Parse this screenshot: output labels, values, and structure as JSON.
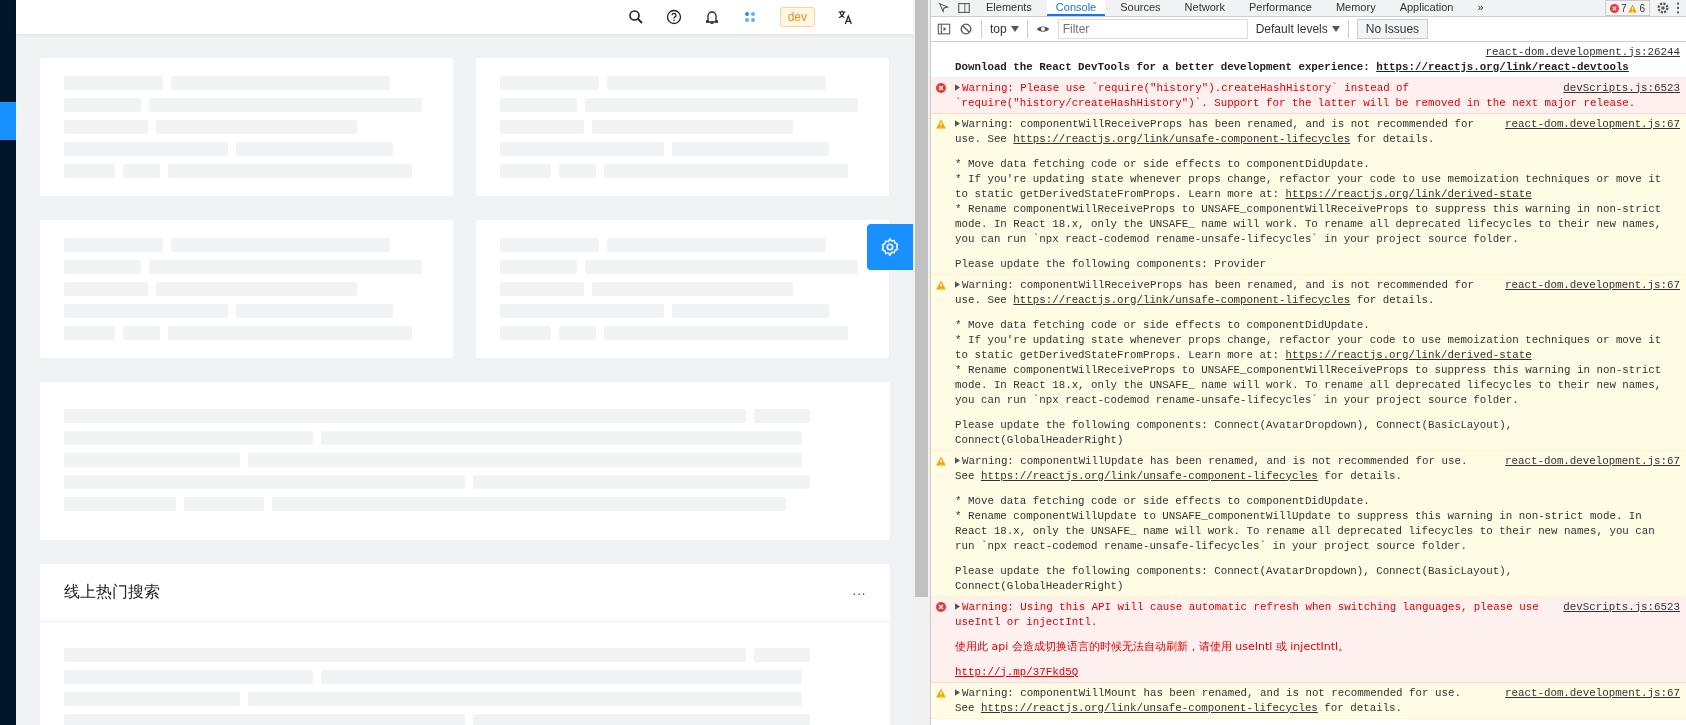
{
  "header": {
    "env_tag": "dev"
  },
  "cards": [
    {
      "kind": "skeleton"
    },
    {
      "kind": "skeleton"
    },
    {
      "kind": "skeleton"
    },
    {
      "kind": "skeleton"
    },
    {
      "kind": "skeleton-wide"
    },
    {
      "kind": "titled",
      "title": "线上热门搜索",
      "more": "···"
    }
  ],
  "devtools": {
    "tabs": [
      {
        "label": "Elements",
        "selected": false
      },
      {
        "label": "Console",
        "selected": true
      },
      {
        "label": "Sources",
        "selected": false
      },
      {
        "label": "Network",
        "selected": false
      },
      {
        "label": "Performance",
        "selected": false
      },
      {
        "label": "Memory",
        "selected": false
      },
      {
        "label": "Application",
        "selected": false
      }
    ],
    "more_tabs": "»",
    "error_count": "7",
    "warning_count": "6",
    "toolbar": {
      "context": "top",
      "filter_placeholder": "Filter",
      "levels": "Default levels",
      "issues": "No Issues"
    },
    "messages": [
      {
        "kind": "info",
        "source": "react-dom.development.js:26244",
        "paragraphs": [
          [
            {
              "text": "Download the React DevTools for a better development experience: ",
              "link": "https://reactjs.org/link/react-devtools"
            }
          ]
        ]
      },
      {
        "kind": "error",
        "source": "devScripts.js:6523",
        "paragraphs": [
          [
            {
              "text": "Warning: Please use `require(\"history\").createHashHistory` instead of"
            },
            {
              "text": "`require(\"history/createHashHistory\")`. Support for the latter will be removed in the next major release."
            }
          ]
        ]
      },
      {
        "kind": "warning",
        "source": "react-dom.development.js:67",
        "paragraphs": [
          [
            {
              "text": "Warning: componentWillReceiveProps has been renamed, and is not recommended for"
            },
            {
              "text": "use. See ",
              "link": "https://reactjs.org/link/unsafe-component-lifecycles",
              "tail": " for details."
            }
          ],
          [
            {
              "text": "* Move data fetching code or side effects to componentDidUpdate."
            },
            {
              "text": "* If you're updating state whenever props change, refactor your code to use memoization techniques or move it"
            },
            {
              "text": "to static getDerivedStateFromProps. Learn more at: ",
              "link": "https://reactjs.org/link/derived-state"
            },
            {
              "text": "* Rename componentWillReceiveProps to UNSAFE_componentWillReceiveProps to suppress this warning in non-strict"
            },
            {
              "text": "mode. In React 18.x, only the UNSAFE_ name will work. To rename all deprecated lifecycles to their new names,"
            },
            {
              "text": "you can run `npx react-codemod rename-unsafe-lifecycles` in your project source folder."
            }
          ],
          [
            {
              "text": "Please update the following components: Provider"
            }
          ]
        ]
      },
      {
        "kind": "warning",
        "source": "react-dom.development.js:67",
        "paragraphs": [
          [
            {
              "text": "Warning: componentWillReceiveProps has been renamed, and is not recommended for"
            },
            {
              "text": "use. See ",
              "link": "https://reactjs.org/link/unsafe-component-lifecycles",
              "tail": " for details."
            }
          ],
          [
            {
              "text": "* Move data fetching code or side effects to componentDidUpdate."
            },
            {
              "text": "* If you're updating state whenever props change, refactor your code to use memoization techniques or move it"
            },
            {
              "text": "to static getDerivedStateFromProps. Learn more at: ",
              "link": "https://reactjs.org/link/derived-state"
            },
            {
              "text": "* Rename componentWillReceiveProps to UNSAFE_componentWillReceiveProps to suppress this warning in non-strict"
            },
            {
              "text": "mode. In React 18.x, only the UNSAFE_ name will work. To rename all deprecated lifecycles to their new names,"
            },
            {
              "text": "you can run `npx react-codemod rename-unsafe-lifecycles` in your project source folder."
            }
          ],
          [
            {
              "text": "Please update the following components: Connect(AvatarDropdown), Connect(BasicLayout),"
            },
            {
              "text": "Connect(GlobalHeaderRight)"
            }
          ]
        ]
      },
      {
        "kind": "warning",
        "source": "react-dom.development.js:67",
        "paragraphs": [
          [
            {
              "text": "Warning: componentWillUpdate has been renamed, and is not recommended for use."
            },
            {
              "text": "See ",
              "link": "https://reactjs.org/link/unsafe-component-lifecycles",
              "tail": " for details."
            }
          ],
          [
            {
              "text": "* Move data fetching code or side effects to componentDidUpdate."
            },
            {
              "text": "* Rename componentWillUpdate to UNSAFE_componentWillUpdate to suppress this warning in non-strict mode. In"
            },
            {
              "text": "React 18.x, only the UNSAFE_ name will work. To rename all deprecated lifecycles to their new names, you can"
            },
            {
              "text": "run `npx react-codemod rename-unsafe-lifecycles` in your project source folder."
            }
          ],
          [
            {
              "text": "Please update the following components: Connect(AvatarDropdown), Connect(BasicLayout),"
            },
            {
              "text": "Connect(GlobalHeaderRight)"
            }
          ]
        ]
      },
      {
        "kind": "error",
        "source": "devScripts.js:6523",
        "paragraphs": [
          [
            {
              "text": "Warning: Using this API will cause automatic refresh when switching languages, please use"
            },
            {
              "text": "useIntl or injectIntl."
            }
          ],
          [
            {
              "text": "使用此 api 会造成切换语言的时候无法自动刷新，请使用 useIntl 或 injectIntl。"
            }
          ],
          [
            {
              "link": "http://j.mp/37Fkd5Q"
            }
          ]
        ]
      },
      {
        "kind": "warning",
        "source": "react-dom.development.js:67",
        "paragraphs": [
          [
            {
              "text": "Warning: componentWillMount has been renamed, and is not recommended for use."
            },
            {
              "text": "See ",
              "link": "https://reactjs.org/link/unsafe-component-lifecycles",
              "tail": " for details."
            }
          ]
        ]
      }
    ]
  }
}
